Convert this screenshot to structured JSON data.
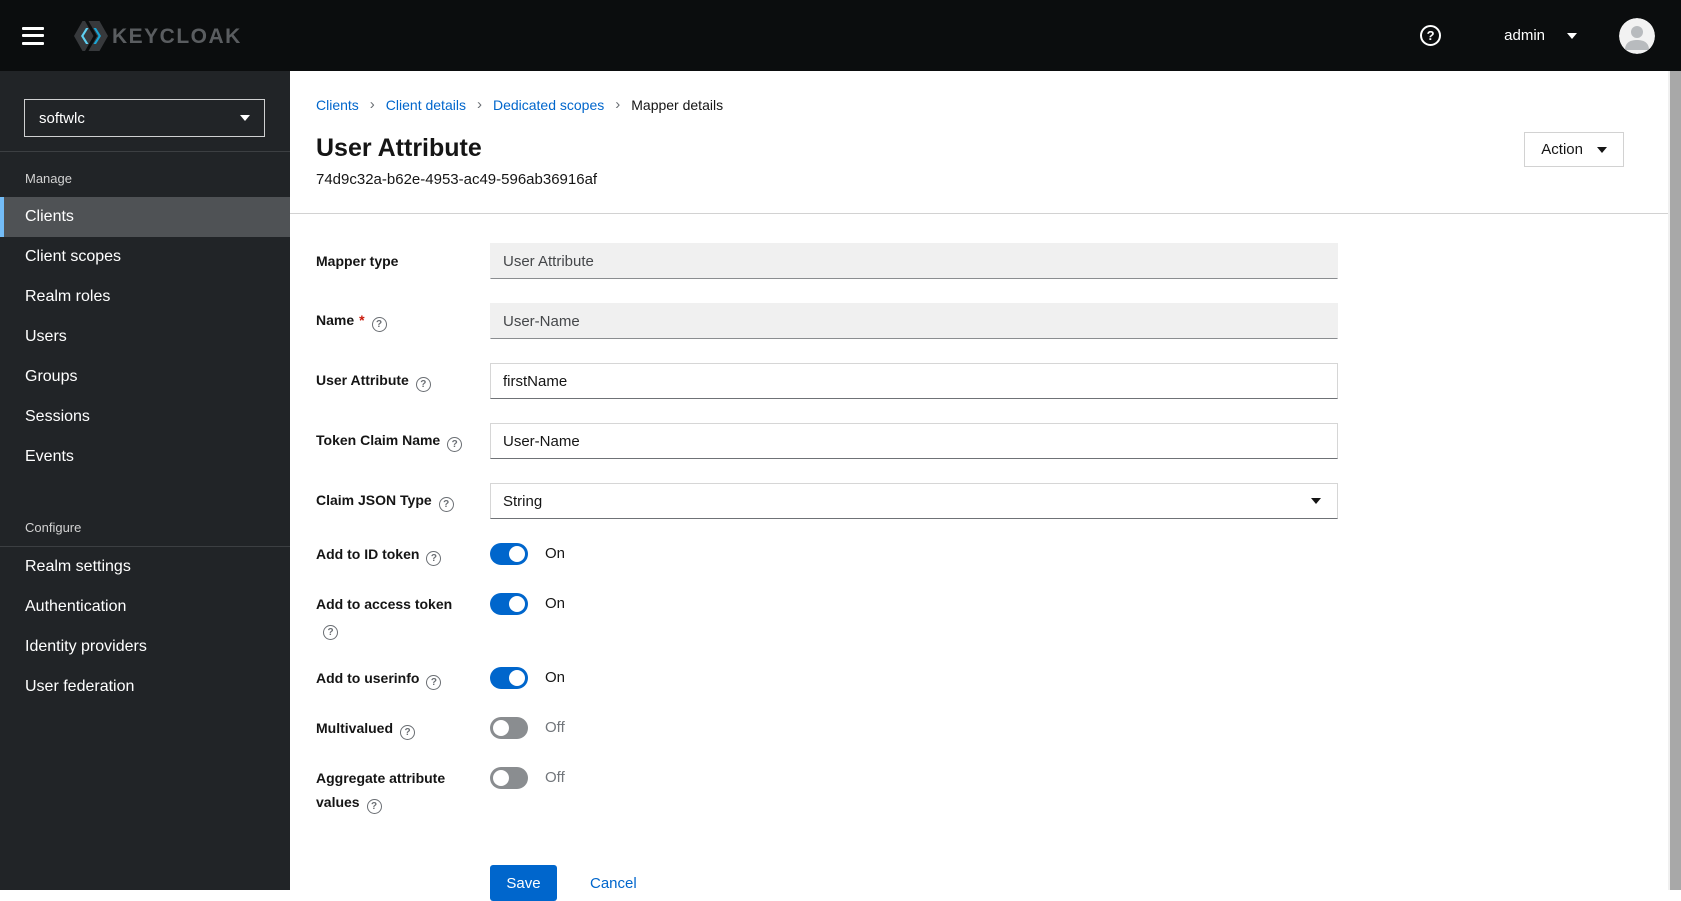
{
  "header": {
    "brand": "KEYCLOAK",
    "username": "admin"
  },
  "sidebar": {
    "realm_selector": {
      "value": "softwlc"
    },
    "sections": [
      {
        "label": "Manage",
        "items": [
          {
            "label": "Clients",
            "active": true
          },
          {
            "label": "Client scopes",
            "active": false
          },
          {
            "label": "Realm roles",
            "active": false
          },
          {
            "label": "Users",
            "active": false
          },
          {
            "label": "Groups",
            "active": false
          },
          {
            "label": "Sessions",
            "active": false
          },
          {
            "label": "Events",
            "active": false
          }
        ]
      },
      {
        "label": "Configure",
        "items": [
          {
            "label": "Realm settings",
            "active": false
          },
          {
            "label": "Authentication",
            "active": false
          },
          {
            "label": "Identity providers",
            "active": false
          },
          {
            "label": "User federation",
            "active": false
          }
        ]
      }
    ]
  },
  "breadcrumb": {
    "items": [
      {
        "label": "Clients",
        "link": true
      },
      {
        "label": "Client details",
        "link": true
      },
      {
        "label": "Dedicated scopes",
        "link": true
      },
      {
        "label": "Mapper details",
        "link": false
      }
    ]
  },
  "page": {
    "title": "User Attribute",
    "subtitle": "74d9c32a-b62e-4953-ac49-596ab36916af",
    "action_label": "Action"
  },
  "form": {
    "mapper_type": {
      "label": "Mapper type",
      "value": "User Attribute",
      "disabled": true
    },
    "name": {
      "label": "Name",
      "value": "User-Name",
      "disabled": true,
      "required_marker": "*"
    },
    "user_attribute": {
      "label": "User Attribute",
      "value": "firstName"
    },
    "token_claim_name": {
      "label": "Token Claim Name",
      "value": "User-Name"
    },
    "claim_json_type": {
      "label": "Claim JSON Type",
      "value": "String"
    },
    "add_to_id_token": {
      "label": "Add to ID token",
      "state": "On"
    },
    "add_to_access_token": {
      "label": "Add to access token",
      "state": "On"
    },
    "add_to_userinfo": {
      "label": "Add to userinfo",
      "state": "On"
    },
    "multivalued": {
      "label": "Multivalued",
      "state": "Off"
    },
    "aggregate_attribute_values": {
      "label": "Aggregate attribute values",
      "state": "Off"
    },
    "save_label": "Save",
    "cancel_label": "Cancel"
  },
  "icons": {
    "help": "?",
    "breadcrumb_separator": "›"
  },
  "colors": {
    "primary": "#0066cc",
    "link": "#0066cc",
    "header_bg": "#0b0d0e",
    "sidebar_bg": "#212427",
    "sidebar_active_bg": "#4f5255",
    "sidebar_active_indicator": "#73bcf7",
    "toggle_on": "#0066cc",
    "toggle_off": "#8a8d90",
    "required": "#c9190b",
    "disabled_input_bg": "#f0f0f0"
  }
}
